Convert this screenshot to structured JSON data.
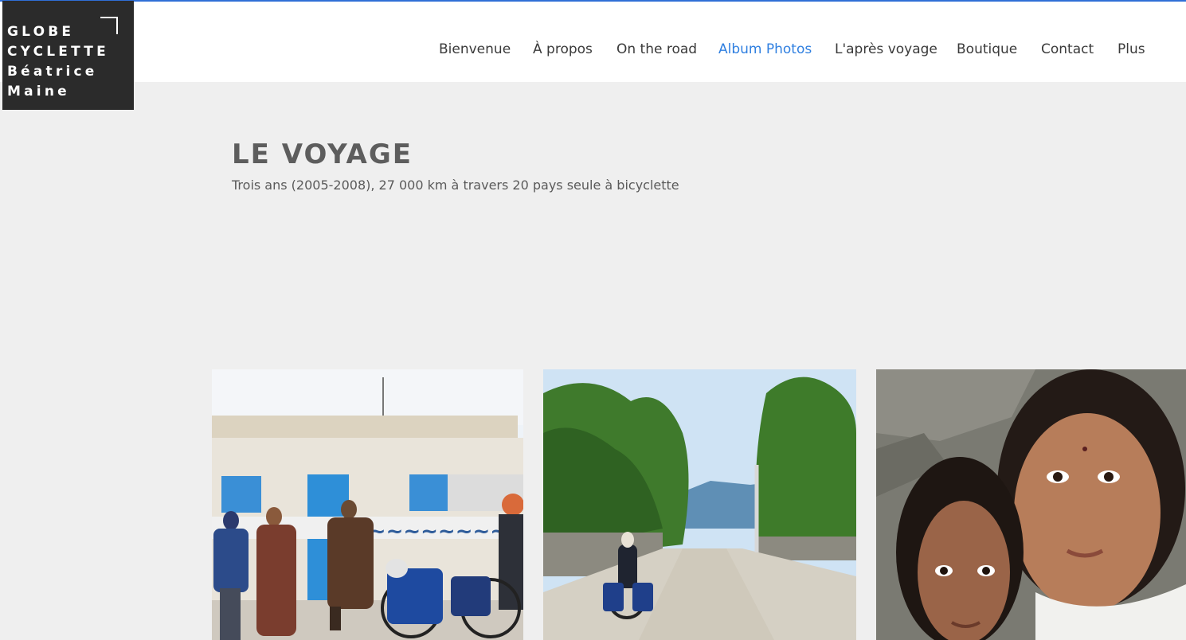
{
  "brand": {
    "lines": [
      "GLOBE",
      "CYCLETTE",
      "Béatrice",
      "Maine"
    ]
  },
  "nav": {
    "items": [
      {
        "label": "Bienvenue"
      },
      {
        "label": "À propos"
      },
      {
        "label": "On the road"
      },
      {
        "label": "Album Photos",
        "active": true
      },
      {
        "label": "L'après voyage"
      },
      {
        "label": "Boutique"
      },
      {
        "label": "Contact"
      },
      {
        "label": "Plus"
      }
    ]
  },
  "colors": {
    "accent": "#2f7fe0",
    "top_border": "#2f6fd6",
    "logo_bg": "#2b2b2b",
    "page_bg": "#efefef"
  },
  "main": {
    "title": "LE VOYAGE",
    "subtitle": "Trois ans (2005-2008), 27 000 km à travers 20 pays seule à bicyclette"
  },
  "gallery": {
    "items": [
      {
        "icon": "photo-men-building-bicycles"
      },
      {
        "icon": "photo-cyclist-country-road"
      },
      {
        "icon": "photo-two-girls"
      }
    ]
  }
}
